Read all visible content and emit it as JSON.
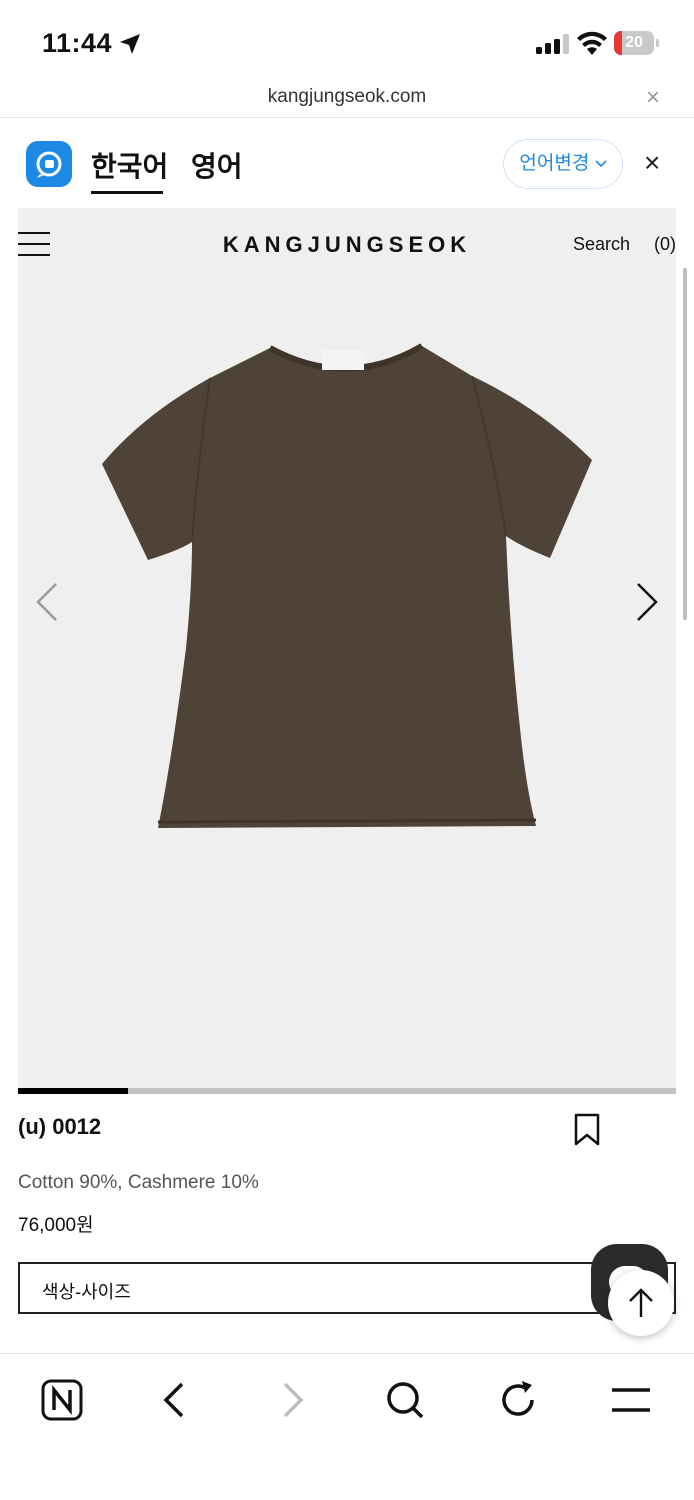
{
  "status_bar": {
    "time": "11:44",
    "battery": "20",
    "battery_level": 0.2,
    "battery_color": "#e53935"
  },
  "browser": {
    "url": "kangjungseok.com",
    "url_close": "×"
  },
  "translate_bar": {
    "active_language": "한국어",
    "other_language": "영어",
    "change_language_button": "언어변경",
    "close": "×",
    "accent_color": "#1e88e5"
  },
  "site": {
    "brand": "KANGJUNGSEOK",
    "search_label": "Search",
    "cart_count": "(0)"
  },
  "gallery": {
    "image_description": "olive-brown short-sleeve t-shirt",
    "slide_progress": 0.167
  },
  "product": {
    "name": "(u) 0012",
    "description": "Cotton 90%, Cashmere 10%",
    "price": "76,000원",
    "option_label": "색상-사이즈",
    "shirt_color": "#4f4236"
  },
  "toolbar": {
    "icons": [
      "naver-home-icon",
      "back-icon",
      "forward-icon",
      "search-icon",
      "refresh-icon",
      "menu-icon"
    ]
  }
}
